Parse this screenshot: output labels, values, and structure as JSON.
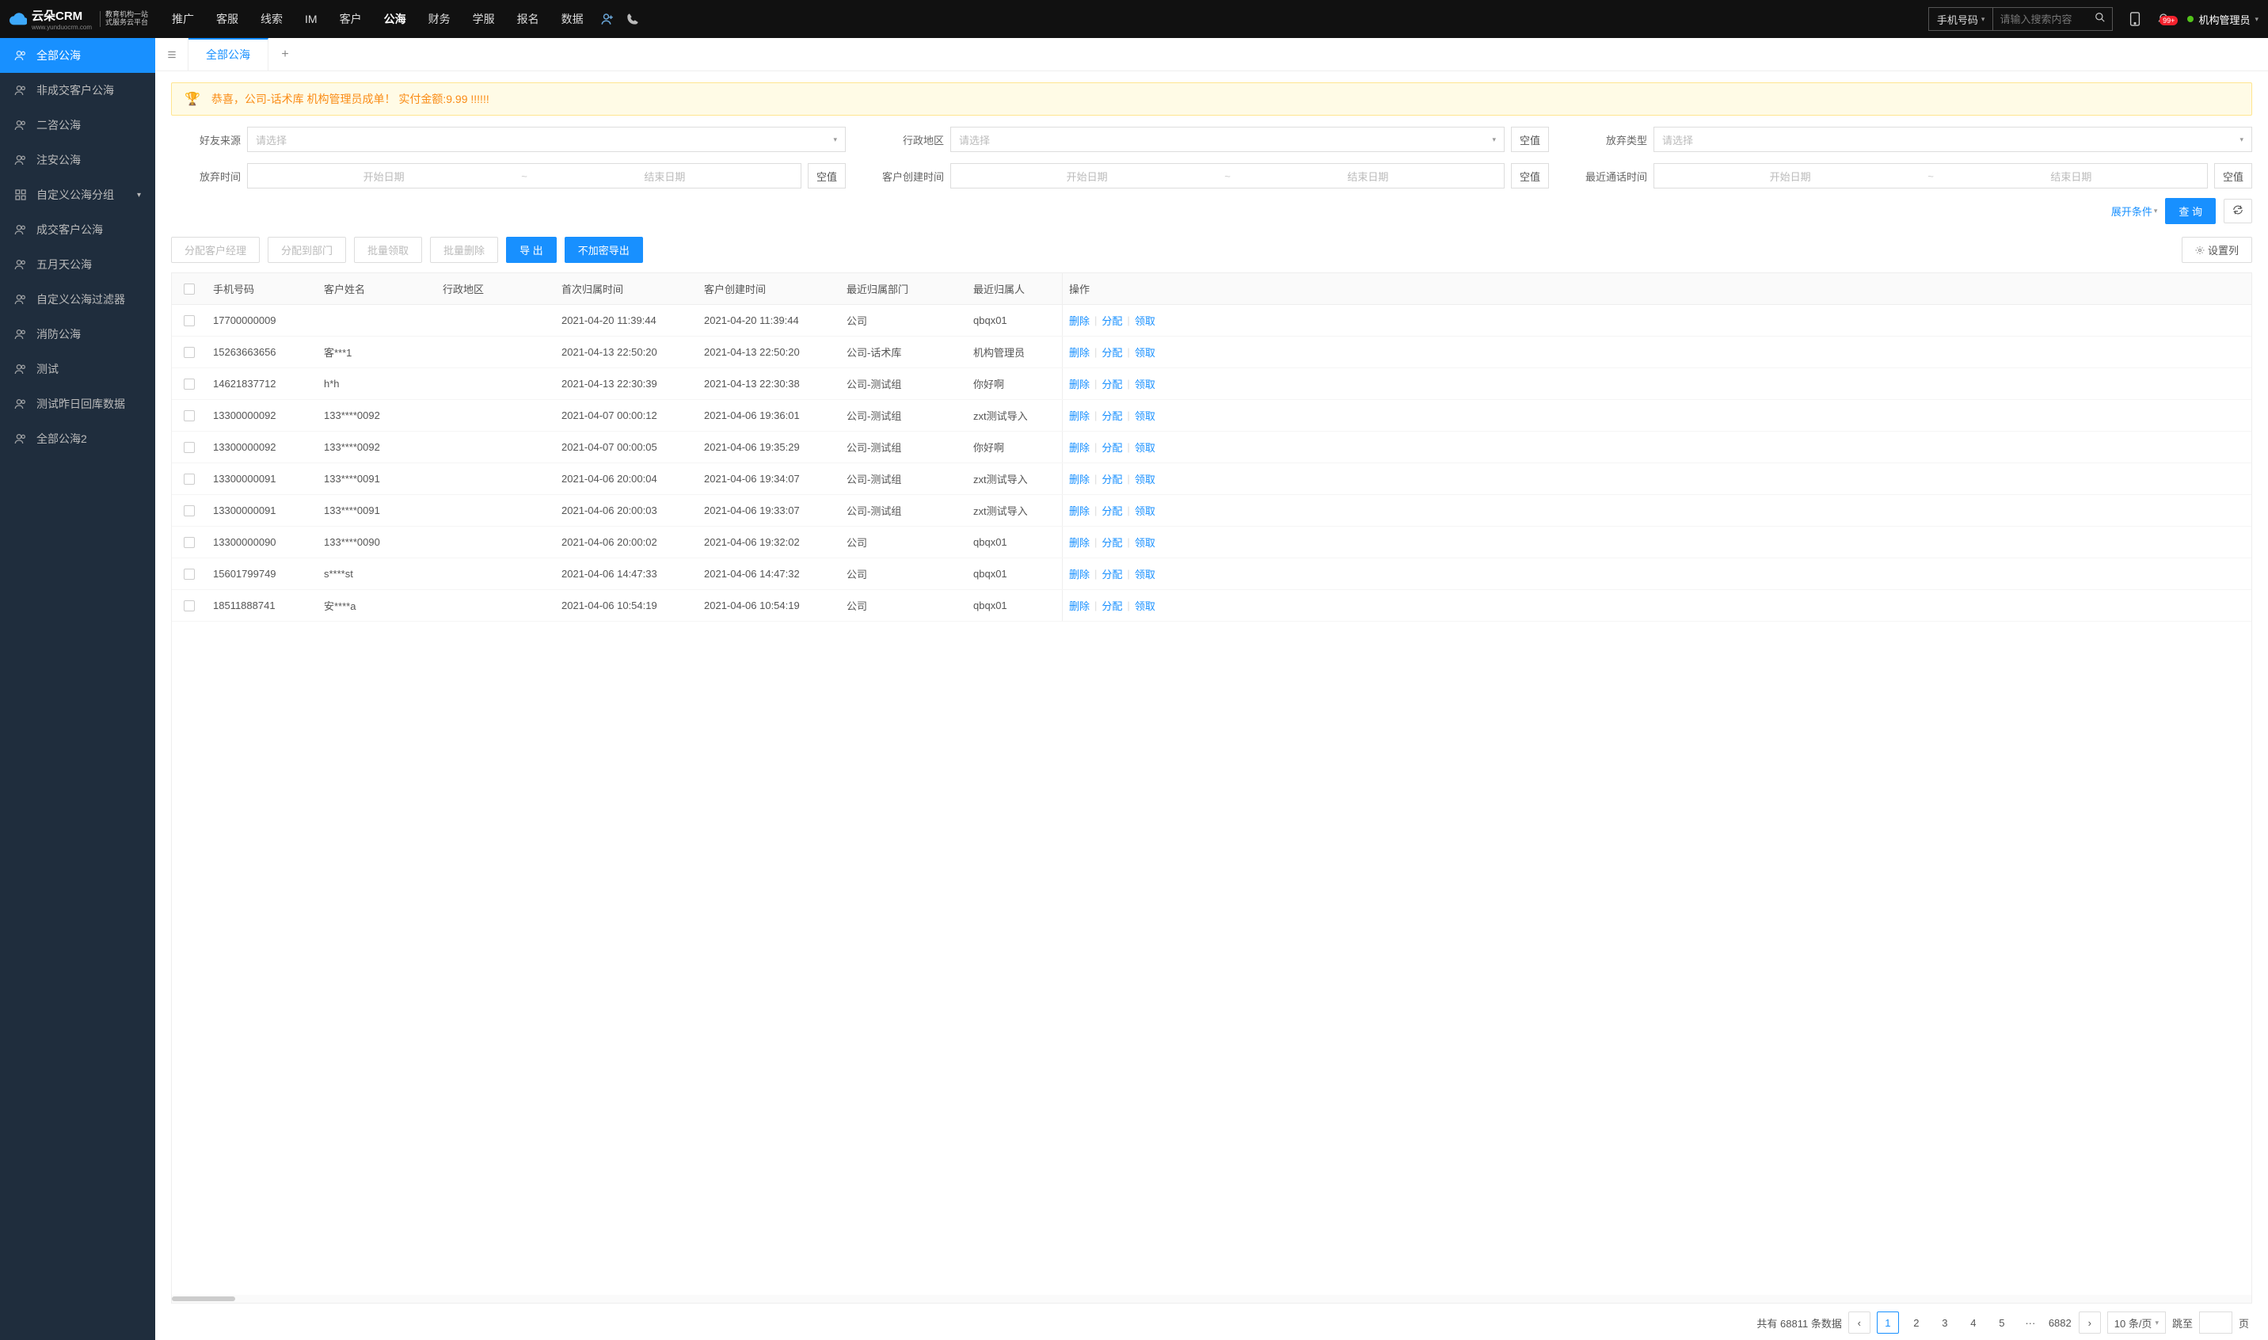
{
  "header": {
    "logo_main": "云朵CRM",
    "logo_sub_top": "教育机构一站",
    "logo_sub_bot": "式服务云平台",
    "logo_url": "www.yunduocrm.com",
    "nav": [
      "推广",
      "客服",
      "线索",
      "IM",
      "客户",
      "公海",
      "财务",
      "学服",
      "报名",
      "数据"
    ],
    "nav_active_index": 5,
    "search_type": "手机号码",
    "search_placeholder": "请输入搜索内容",
    "badge": "99+",
    "user": "机构管理员"
  },
  "sidebar": [
    {
      "label": "全部公海",
      "active": true,
      "icon": "users"
    },
    {
      "label": "非成交客户公海",
      "icon": "users"
    },
    {
      "label": "二咨公海",
      "icon": "users"
    },
    {
      "label": "注安公海",
      "icon": "users"
    },
    {
      "label": "自定义公海分组",
      "icon": "grid",
      "chevron": true
    },
    {
      "label": "成交客户公海",
      "icon": "users"
    },
    {
      "label": "五月天公海",
      "icon": "users"
    },
    {
      "label": "自定义公海过滤器",
      "icon": "users"
    },
    {
      "label": "消防公海",
      "icon": "users"
    },
    {
      "label": "测试",
      "icon": "users"
    },
    {
      "label": "测试昨日回库数据",
      "icon": "users"
    },
    {
      "label": "全部公海2",
      "icon": "users"
    }
  ],
  "tabs": {
    "active": "全部公海"
  },
  "banner": "恭喜，公司-话术库  机构管理员成单！  实付金额:9.99 !!!!!!",
  "filters": {
    "placeholder_select": "请选择",
    "placeholder_start": "开始日期",
    "placeholder_end": "结束日期",
    "null_btn": "空值",
    "rows": [
      {
        "label": "好友来源",
        "type": "select"
      },
      {
        "label": "行政地区",
        "type": "select",
        "null": true
      },
      {
        "label": "放弃类型",
        "type": "select"
      },
      {
        "label": "放弃时间",
        "type": "range",
        "null": true
      },
      {
        "label": "客户创建时间",
        "type": "range",
        "null": true
      },
      {
        "label": "最近通话时间",
        "type": "range",
        "null": true
      }
    ],
    "expand": "展开条件",
    "search_btn": "查 询"
  },
  "actions": {
    "assign_manager": "分配客户经理",
    "assign_dept": "分配到部门",
    "batch_claim": "批量领取",
    "batch_delete": "批量删除",
    "export": "导 出",
    "export_noenc": "不加密导出",
    "set_columns": "设置列"
  },
  "table": {
    "headers": [
      "手机号码",
      "客户姓名",
      "行政地区",
      "首次归属时间",
      "客户创建时间",
      "最近归属部门",
      "最近归属人",
      "操作"
    ],
    "ops": {
      "delete": "删除",
      "assign": "分配",
      "claim": "领取"
    },
    "rows": [
      {
        "phone": "17700000009",
        "name": "",
        "region": "",
        "first": "2021-04-20 11:39:44",
        "create": "2021-04-20 11:39:44",
        "dept": "公司",
        "owner": "qbqx01"
      },
      {
        "phone": "15263663656",
        "name": "客***1",
        "region": "",
        "first": "2021-04-13 22:50:20",
        "create": "2021-04-13 22:50:20",
        "dept": "公司-话术库",
        "owner": "机构管理员"
      },
      {
        "phone": "14621837712",
        "name": "h*h",
        "region": "",
        "first": "2021-04-13 22:30:39",
        "create": "2021-04-13 22:30:38",
        "dept": "公司-测试组",
        "owner": "你好啊"
      },
      {
        "phone": "13300000092",
        "name": "133****0092",
        "region": "",
        "first": "2021-04-07 00:00:12",
        "create": "2021-04-06 19:36:01",
        "dept": "公司-测试组",
        "owner": "zxt测试导入"
      },
      {
        "phone": "13300000092",
        "name": "133****0092",
        "region": "",
        "first": "2021-04-07 00:00:05",
        "create": "2021-04-06 19:35:29",
        "dept": "公司-测试组",
        "owner": "你好啊"
      },
      {
        "phone": "13300000091",
        "name": "133****0091",
        "region": "",
        "first": "2021-04-06 20:00:04",
        "create": "2021-04-06 19:34:07",
        "dept": "公司-测试组",
        "owner": "zxt测试导入"
      },
      {
        "phone": "13300000091",
        "name": "133****0091",
        "region": "",
        "first": "2021-04-06 20:00:03",
        "create": "2021-04-06 19:33:07",
        "dept": "公司-测试组",
        "owner": "zxt测试导入"
      },
      {
        "phone": "13300000090",
        "name": "133****0090",
        "region": "",
        "first": "2021-04-06 20:00:02",
        "create": "2021-04-06 19:32:02",
        "dept": "公司",
        "owner": "qbqx01"
      },
      {
        "phone": "15601799749",
        "name": "s****st",
        "region": "",
        "first": "2021-04-06 14:47:33",
        "create": "2021-04-06 14:47:32",
        "dept": "公司",
        "owner": "qbqx01"
      },
      {
        "phone": "18511888741",
        "name": "安****a",
        "region": "",
        "first": "2021-04-06 10:54:19",
        "create": "2021-04-06 10:54:19",
        "dept": "公司",
        "owner": "qbqx01"
      }
    ]
  },
  "pager": {
    "total_prefix": "共有",
    "total": "68811",
    "total_suffix": "条数据",
    "pages": [
      "1",
      "2",
      "3",
      "4",
      "5"
    ],
    "ellipsis": "···",
    "last": "6882",
    "per_page": "10 条/页",
    "jump_label": "跳至",
    "jump_suffix": "页"
  }
}
